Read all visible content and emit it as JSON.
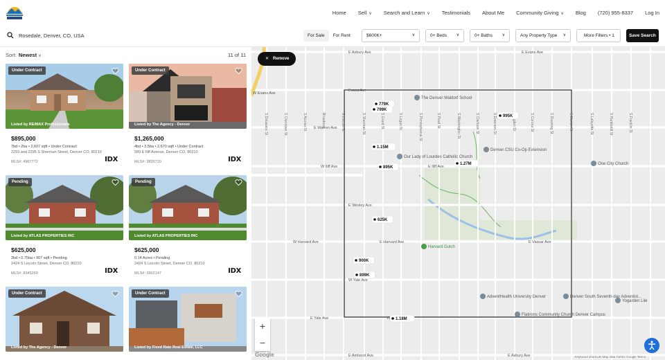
{
  "nav": {
    "links": [
      "Home",
      "Sell",
      "Search and Learn",
      "Testimonials",
      "About Me",
      "Community Giving",
      "Blog",
      "(720) 955-8337",
      "Log In"
    ]
  },
  "filters": {
    "search_value": "Rosedale, Denver, CO, USA",
    "for_sale": "For Sale",
    "for_rent": "For Rent",
    "price": "$600K+",
    "beds": "0+ Beds",
    "baths": "0+ Baths",
    "type": "Any Property Type",
    "more": "More Filters • 1",
    "save": "Save Search"
  },
  "list": {
    "sort_label": "Sort:",
    "sort_value": "Newest",
    "count": "11 of 11",
    "cards": [
      {
        "badge": "Under Contract",
        "listed": "Listed by RE/MAX Professionals",
        "price": "$895,000",
        "details": "7bd • 2ba • 2,607 sqft • Under Contract",
        "address": "2293 and 2295 S Sherman Street, Denver CO, 80210",
        "mls": "MLS#: 4967772",
        "logo": "IDX"
      },
      {
        "badge": "Under Contract",
        "listed": "Listed by The Agency - Denver",
        "price": "$1,265,000",
        "details": "4bd • 3.5ba • 2,670 sqft • Under Contract",
        "address": "589 E Iliff Avenue, Denver CO, 80210",
        "mls": "MLS#: 3895710",
        "logo": "IDX"
      },
      {
        "badge": "Pending",
        "listed": "Listed by ATLAS PROPERTIES INC",
        "price": "$625,000",
        "details": "2bd • 0.75ba • 907 sqft • Pending",
        "address": "2424 S Lincoln Street, Denver CO, 80210",
        "mls": "MLS#: 8345269",
        "logo": "IDX"
      },
      {
        "badge": "Pending",
        "listed": "Listed by ATLAS PROPERTIES INC",
        "price": "$625,000",
        "details": "0.14 Acres • Pending",
        "address": "2424 S Lincoln Street, Denver CO, 80210",
        "mls": "MLS#: 3902147",
        "logo": "IDX"
      },
      {
        "badge": "Under Contract",
        "listed": "Listed by The Agency - Denver",
        "price": "",
        "details": "",
        "address": "",
        "mls": "",
        "logo": ""
      },
      {
        "badge": "Under Contract",
        "listed": "Listed by Fixed Rate Real Estate, LLC",
        "price": "",
        "details": "",
        "address": "",
        "mls": "",
        "logo": ""
      }
    ]
  },
  "map": {
    "remove": "Remove",
    "zoom_in": "+",
    "zoom_out": "−",
    "google": "Google",
    "credits": "Keyboard shortcuts   Map data ©2024 Google   Terms",
    "markers": [
      "779K",
      "799K",
      "995K",
      "1.15M",
      "1.27M",
      "895K",
      "625K",
      "900K",
      "899K",
      "1.18M"
    ],
    "pois": [
      "The Denver Waldorf School",
      "Our Lady of Lourdes Catholic Church",
      "Denver CSU Co-Op Extension",
      "One City Church",
      "Harvard Gulch",
      "AdventHealth University Denver",
      "Denver South Seventh-day Adventist...",
      "Flatirons Community Church Denver Campus",
      "Yogarden Lile"
    ],
    "streets_h": [
      "E Asbury Ave",
      "W Evans Ave",
      "Evans Ave",
      "E Evans Ave",
      "E Warren Ave",
      "W Iliff Ave",
      "E Iliff Ave",
      "E Wesley Ave",
      "W Harvard Ave",
      "E Harvard Ave",
      "E Vassar Ave",
      "W Yale Ave",
      "E Yale Ave",
      "W Amherst Ave",
      "E Amherst Ave"
    ],
    "streets_v": [
      "S Delaware St",
      "S Cherokee St",
      "S Acoma St",
      "Broadway",
      "S Lincoln St",
      "S Sherman St",
      "S Grant St",
      "S Logan St",
      "S Pennsylvania St",
      "S Pearl St",
      "S Washington St",
      "S Clarkson St",
      "S Emerson St",
      "S Ogden St",
      "S Corona St",
      "S Downing St",
      "S Marion St",
      "S Lafayette St",
      "S Humboldt St",
      "S Franklin St"
    ]
  }
}
